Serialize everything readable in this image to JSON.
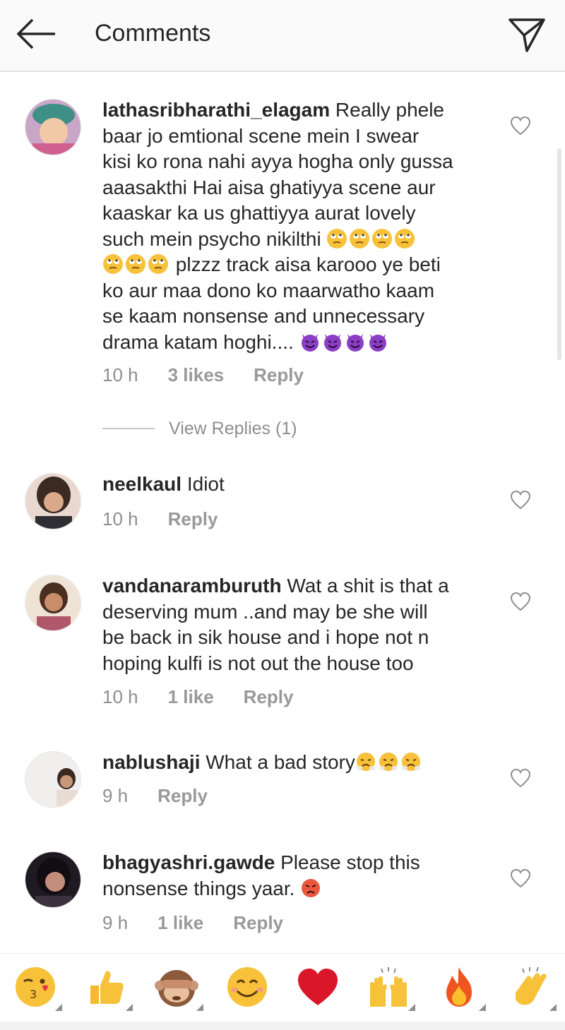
{
  "header": {
    "title": "Comments"
  },
  "comments": [
    {
      "username": "lathasribharathi_elagam",
      "lines": [
        " Really phele",
        "baar jo emtional scene mein I swear",
        "kisi ko rona nahi ayya hogha only gussa",
        "aaasakthi Hai aisa ghatiyya scene aur",
        "kaaskar ka us ghattiyya aurat lovely",
        "such mein psycho nikilthi ",
        " plzzz track aisa karooo ye beti",
        "ko aur maa dono ko maarwatho kaam",
        "se kaam nonsense and unnecessary",
        "drama katam hoghi.... "
      ],
      "time": "10 h",
      "likes": "3 likes",
      "reply": "Reply",
      "view_replies": "View Replies (1)"
    },
    {
      "username": "neelkaul",
      "text": " Idiot",
      "time": "10 h",
      "reply": "Reply"
    },
    {
      "username": "vandanaramburuth",
      "lines": [
        " Wat a shit is that a",
        "deserving mum ..and may be she will",
        "be back in sik house and i hope not n",
        "hoping kulfi is not out the house too"
      ],
      "time": "10 h",
      "likes": "1 like",
      "reply": "Reply"
    },
    {
      "username": "nablushaji",
      "text": " What a bad story",
      "time": "9 h",
      "reply": "Reply"
    },
    {
      "username": "bhagyashri.gawde",
      "lines": [
        " Please stop this",
        "nonsense things yaar. "
      ],
      "time": "9 h",
      "likes": "1 like",
      "reply": "Reply"
    }
  ],
  "quick_emojis": [
    "kissing-wink-emoji",
    "thumbs-up-emoji",
    "see-no-evil-monkey-emoji",
    "smiling-face-emoji",
    "red-heart-emoji",
    "raising-hands-emoji",
    "fire-emoji",
    "clapping-hands-emoji"
  ],
  "colors": {
    "text": "#262626",
    "meta": "#8e8e8e",
    "header_bg": "#fafafa"
  }
}
